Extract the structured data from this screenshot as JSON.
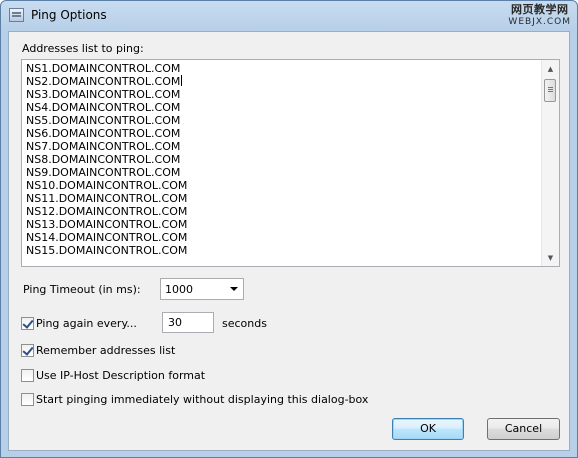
{
  "window": {
    "title": "Ping Options"
  },
  "watermark": {
    "line1": "网页教学网",
    "line2": "WEBJX.COM"
  },
  "addresses": {
    "label": "Addresses list to ping:",
    "items": [
      "NS1.DOMAINCONTROL.COM",
      "NS2.DOMAINCONTROL.COM",
      "NS3.DOMAINCONTROL.COM",
      "NS4.DOMAINCONTROL.COM",
      "NS5.DOMAINCONTROL.COM",
      "NS6.DOMAINCONTROL.COM",
      "NS7.DOMAINCONTROL.COM",
      "NS8.DOMAINCONTROL.COM",
      "NS9.DOMAINCONTROL.COM",
      "NS10.DOMAINCONTROL.COM",
      "NS11.DOMAINCONTROL.COM",
      "NS12.DOMAINCONTROL.COM",
      "NS13.DOMAINCONTROL.COM",
      "NS14.DOMAINCONTROL.COM",
      "NS15.DOMAINCONTROL.COM"
    ]
  },
  "timeout": {
    "label": "Ping Timeout (in ms):",
    "value": "1000"
  },
  "ping_again": {
    "label": "Ping again every...",
    "checked": true,
    "value": "30",
    "unit": "seconds"
  },
  "options": {
    "remember_label": "Remember addresses list",
    "remember_checked": true,
    "iphost_label": "Use IP-Host Description format",
    "iphost_checked": false,
    "start_label": "Start pinging immediately without displaying this dialog-box",
    "start_checked": false
  },
  "buttons": {
    "ok": "OK",
    "cancel": "Cancel"
  },
  "icons": {
    "app": "ping-window-icon",
    "scroll_up": "scroll-up-arrow-icon",
    "scroll_down": "scroll-down-arrow-icon",
    "dropdown": "chevron-down-icon",
    "check": "checkmark-icon"
  }
}
